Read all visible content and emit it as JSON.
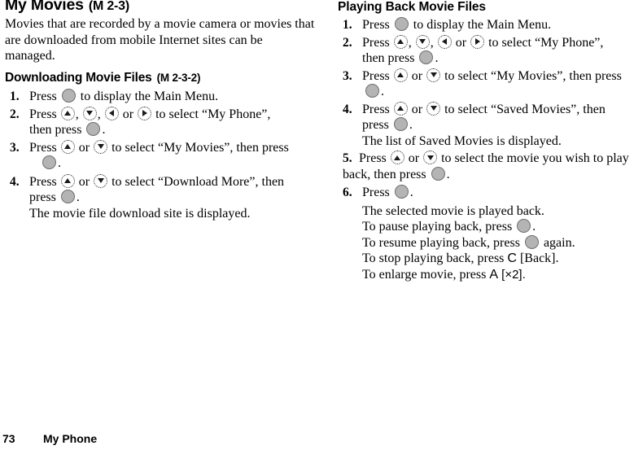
{
  "document": {
    "footer": {
      "page_number": "73",
      "chapter": "My Phone"
    }
  },
  "left_column": {
    "title": "My Movies",
    "title_code": "(M 2-3)",
    "intro": "Movies that are recorded by a movie camera or movies that are downloaded from mobile Internet sites can be managed.",
    "section": {
      "heading": "Downloading Movie Files",
      "heading_code": "(M 2-3-2)",
      "steps": [
        {
          "number": "1.",
          "lines": [
            {
              "before": "Press ",
              "icons": [
                "center"
              ],
              "after": " to display the Main Menu."
            }
          ]
        },
        {
          "number": "2.",
          "lines": [
            {
              "before": "Press ",
              "icons": [
                "up",
                "down",
                "left",
                "right"
              ],
              "after": " to select “My Phone”,"
            },
            {
              "before": "then press ",
              "icons": [
                "center"
              ],
              "after": "."
            }
          ]
        },
        {
          "number": "3.",
          "lines": [
            {
              "before": "Press ",
              "icons": [
                "up",
                "down"
              ],
              "after": " to select “My Movies”, then press"
            },
            {
              "before": "",
              "icons": [
                "center"
              ],
              "after": "."
            }
          ]
        },
        {
          "number": "4.",
          "lines": [
            {
              "before": "Press ",
              "icons": [
                "up",
                "down"
              ],
              "after": " to select “Download More”, then"
            },
            {
              "before": "press ",
              "icons": [
                "center"
              ],
              "after": "."
            }
          ],
          "note": "The movie file download site is displayed."
        }
      ]
    }
  },
  "right_column": {
    "heading": "Playing Back Movie Files",
    "steps": [
      {
        "number": "1.",
        "lines": [
          {
            "before": "Press ",
            "icons": [
              "center"
            ],
            "after": " to display the Main Menu."
          }
        ]
      },
      {
        "number": "2.",
        "lines": [
          {
            "before": "Press ",
            "icons": [
              "up",
              "down",
              "left",
              "right"
            ],
            "after": " to select “My Phone”,"
          },
          {
            "before": "then press ",
            "icons": [
              "center"
            ],
            "after": "."
          }
        ]
      },
      {
        "number": "3.",
        "lines": [
          {
            "before": "Press ",
            "icons": [
              "up",
              "down"
            ],
            "after": " to select “My Movies”, then press"
          },
          {
            "before": "",
            "icons": [
              "center"
            ],
            "after": "."
          }
        ]
      },
      {
        "number": "4.",
        "lines": [
          {
            "before": "Press ",
            "icons": [
              "up",
              "down"
            ],
            "after": " to select “Saved Movies”, then"
          },
          {
            "before": "press ",
            "icons": [
              "center"
            ],
            "after": "."
          }
        ],
        "note": "The list of Saved Movies is displayed."
      },
      {
        "number": "5.",
        "lines": [
          {
            "before": "Press ",
            "icons": [
              "up",
              "down"
            ],
            "after": " to select the movie you wish to play"
          },
          {
            "before": "back, then press ",
            "icons": [
              "center"
            ],
            "after": "."
          }
        ]
      },
      {
        "number": "6.",
        "lines": [
          {
            "before": "Press ",
            "icons": [
              "center"
            ],
            "after": "."
          }
        ],
        "notes": [
          "The selected movie is played back.",
          "To pause playing back, press ",
          "To resume playing back, press ",
          "To stop playing back, press ",
          "To enlarge movie, press "
        ]
      }
    ],
    "playback_notes": {
      "played_back": "The selected movie is played back.",
      "pause_before": "To pause playing back, press ",
      "pause_after": ".",
      "resume_before": "To resume playing back, press ",
      "resume_after": " again.",
      "stop_before": "To stop playing back, press ",
      "stop_key": "C",
      "stop_after": " [Back].",
      "enlarge_before": "To enlarge movie, press ",
      "enlarge_key": "A",
      "enlarge_after": " [×2]."
    }
  }
}
